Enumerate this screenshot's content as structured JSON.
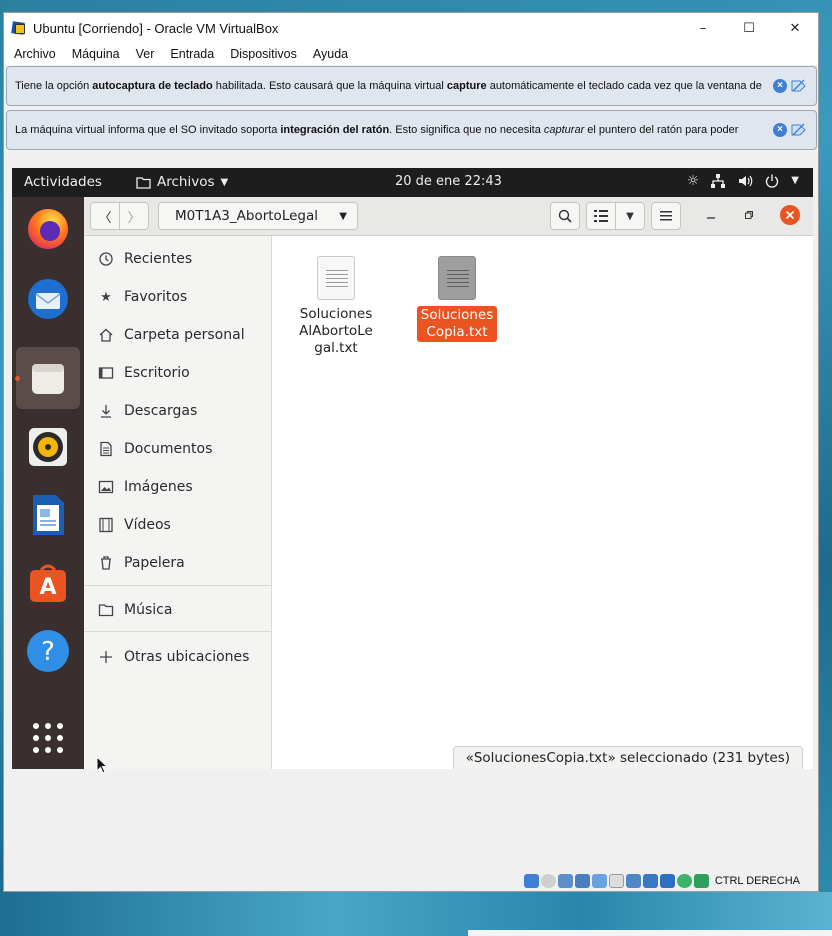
{
  "window": {
    "title": "Ubuntu [Corriendo] - Oracle VM VirtualBox",
    "minimize": "–",
    "maximize": "☐",
    "close": "✕"
  },
  "menu": [
    "Archivo",
    "Máquina",
    "Ver",
    "Entrada",
    "Dispositivos",
    "Ayuda"
  ],
  "notices": {
    "keyboard": {
      "pre": "Tiene la opción ",
      "b1": "autocaptura de teclado",
      "mid": " habilitada. Esto causará que la máquina virtual ",
      "b2": "capture",
      "post": " automáticamente el teclado cada vez que la ventana de"
    },
    "mouse": {
      "pre": "La máquina virtual informa que el SO invitado soporta ",
      "b1": "integración del ratón",
      "mid": ". Esto significa que no necesita ",
      "i1": "capturar",
      "post": " el puntero del ratón para poder"
    }
  },
  "topbar": {
    "activities": "Actividades",
    "app": "Archivos",
    "clock": "20 de ene  22:43"
  },
  "dock": [
    "firefox-icon",
    "thunderbird-icon",
    "files-icon",
    "rhythmbox-icon",
    "libreoffice-writer-icon",
    "software-icon",
    "help-icon",
    "app-grid-icon"
  ],
  "headerbar": {
    "path": "M0T1A3_AbortoLegal"
  },
  "sidebar": {
    "items": [
      {
        "label": "Recientes",
        "icon": "clock-icon"
      },
      {
        "label": "Favoritos",
        "icon": "star-icon"
      },
      {
        "label": "Carpeta personal",
        "icon": "home-icon"
      },
      {
        "label": "Escritorio",
        "icon": "desktop-icon"
      },
      {
        "label": "Descargas",
        "icon": "download-icon"
      },
      {
        "label": "Documentos",
        "icon": "document-icon"
      },
      {
        "label": "Imágenes",
        "icon": "image-icon"
      },
      {
        "label": "Vídeos",
        "icon": "video-icon"
      },
      {
        "label": "Papelera",
        "icon": "trash-icon"
      },
      {
        "label": "Música",
        "icon": "folder-icon"
      },
      {
        "label": "Otras ubicaciones",
        "icon": "plus-icon"
      }
    ]
  },
  "files": [
    {
      "name": "Soluciones\nAlAbortoLe\ngal.txt",
      "selected": false
    },
    {
      "name": "Soluciones\nCopia.txt",
      "selected": true
    }
  ],
  "status": "«SolucionesCopia.txt» seleccionado  (231 bytes)",
  "vbox_status": {
    "host_key": "CTRL DERECHA"
  },
  "colors": {
    "accent": "#e95420",
    "dock_bg": "#3a2f2f",
    "topbar_bg": "#1d1d1d"
  }
}
